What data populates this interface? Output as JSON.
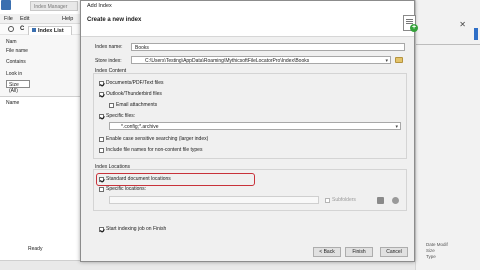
{
  "background_app": {
    "window_title": "Index Manager",
    "menu": {
      "file": "File",
      "edit": "Edit",
      "help": "Help"
    },
    "tab": {
      "icon": "list-icon",
      "label": "Index List"
    },
    "toolbar_label": "C",
    "panel_labels": [
      "Nam",
      "File name",
      "Contains",
      "Look in"
    ],
    "size_dropdown": "Size (All)",
    "column_header": "Name",
    "status": "Ready",
    "right_panel_labels": [
      "Date Modif",
      "Size",
      "Type"
    ]
  },
  "dialog": {
    "window_title": "Add Index",
    "header": {
      "title": "Create a new index",
      "icon": "index-add-icon"
    },
    "index_name": {
      "label": "Index name:",
      "value": "Books"
    },
    "store_index": {
      "label": "Store index:",
      "value": "C:\\Users\\Testing\\AppData\\Roaming\\MythicsoftFileLocatorPro\\Index\\Books"
    },
    "index_content": {
      "title": "Index Content",
      "documents": {
        "label": "Documents/PDF/Text files",
        "checked": true
      },
      "outlook": {
        "label": "Outlook/Thunderbird files",
        "checked": true
      },
      "email_attachments": {
        "label": "Email attachments",
        "checked": false
      },
      "specific_files": {
        "label": "Specific files:",
        "checked": true
      },
      "file_pattern": "*.config;*.archive",
      "case_sensitive": {
        "label": "Enable case sensitive searching (larger index)",
        "checked": false
      },
      "non_content": {
        "label": "Include file names for non-content file types",
        "checked": false
      }
    },
    "index_locations": {
      "title": "Index Locations",
      "standard_locations": {
        "label": "Standard document locations",
        "checked": true
      },
      "specific_locations": {
        "label": "Specific locations:",
        "checked": false
      },
      "subfolders": {
        "label": "Subfolders",
        "checked": false
      }
    },
    "start_indexing": {
      "label": "Start indexing job on Finish",
      "checked": true
    },
    "buttons": {
      "back": "< Back",
      "finish": "Finish",
      "cancel": "Cancel"
    }
  },
  "colors": {
    "highlight": "#c8323a",
    "dialog_bg": "#f0f0f0",
    "header_bg": "#ffffff"
  }
}
